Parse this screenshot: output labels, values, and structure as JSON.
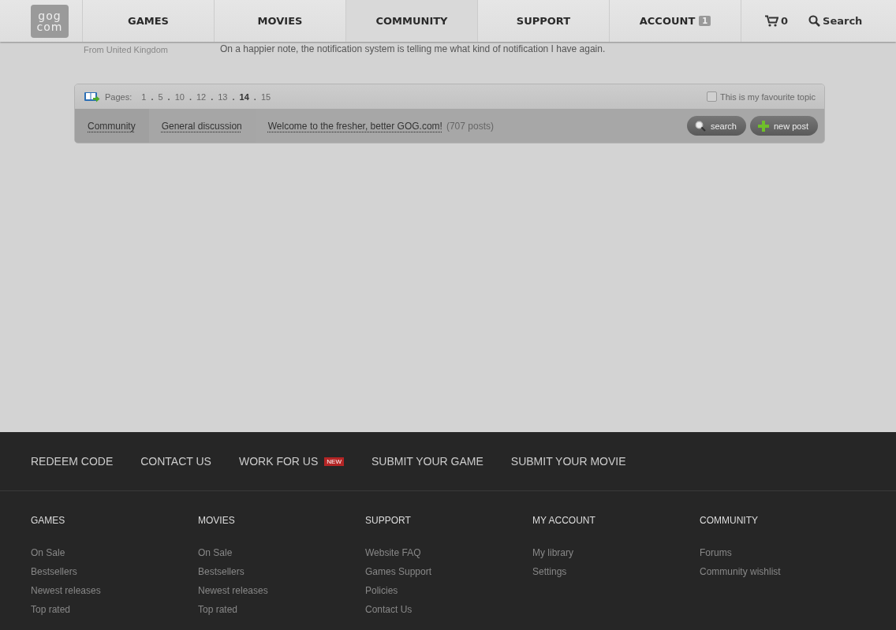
{
  "logo": [
    "gog",
    "com"
  ],
  "nav": [
    {
      "label": "GAMES",
      "selected": false
    },
    {
      "label": "MOVIES",
      "selected": false
    },
    {
      "label": "COMMUNITY",
      "selected": true
    },
    {
      "label": "SUPPORT",
      "selected": false
    },
    {
      "label": "ACCOUNT",
      "selected": false,
      "badge": "1"
    }
  ],
  "cart": {
    "count": "0"
  },
  "search": {
    "label": "Search"
  },
  "post_tail": {
    "author_location": "From United Kingdom",
    "text": "On a happier note, the notification system is telling me what kind of notification I have again."
  },
  "topic_bar": {
    "pages_label": "Pages:",
    "page_separator": ".",
    "pages": [
      {
        "label": "1",
        "selected": false
      },
      {
        "label": "5",
        "selected": false
      },
      {
        "label": "10",
        "selected": false
      },
      {
        "label": "12",
        "selected": false
      },
      {
        "label": "13",
        "selected": false
      },
      {
        "label": "14",
        "selected": true
      },
      {
        "label": "15",
        "selected": false
      }
    ],
    "favourite": {
      "label": "This is my favourite topic",
      "checked": false
    },
    "breadcrumbs": [
      "Community",
      "General discussion",
      "Welcome to the fresher, better GOG.com!"
    ],
    "post_count": "(707 posts)",
    "buttons": [
      {
        "kind": "search",
        "label": "search"
      },
      {
        "kind": "new",
        "label": "new post"
      }
    ]
  },
  "footer": {
    "links": [
      {
        "label": "REDEEM CODE"
      },
      {
        "label": "CONTACT US"
      },
      {
        "label": "WORK FOR US",
        "badge": "NEW"
      },
      {
        "label": "SUBMIT YOUR GAME"
      },
      {
        "label": "SUBMIT YOUR MOVIE"
      }
    ],
    "columns": [
      {
        "title": "GAMES",
        "items": [
          "On Sale",
          "Bestsellers",
          "Newest releases",
          "Top rated"
        ]
      },
      {
        "title": "MOVIES",
        "items": [
          "On Sale",
          "Bestsellers",
          "Newest releases",
          "Top rated"
        ]
      },
      {
        "title": "SUPPORT",
        "items": [
          "Website FAQ",
          "Games Support",
          "Policies",
          "Contact Us"
        ]
      },
      {
        "title": "MY ACCOUNT",
        "items": [
          "My library",
          "Settings"
        ]
      },
      {
        "title": "COMMUNITY",
        "items": [
          "Forums",
          "Community wishlist"
        ]
      }
    ]
  }
}
